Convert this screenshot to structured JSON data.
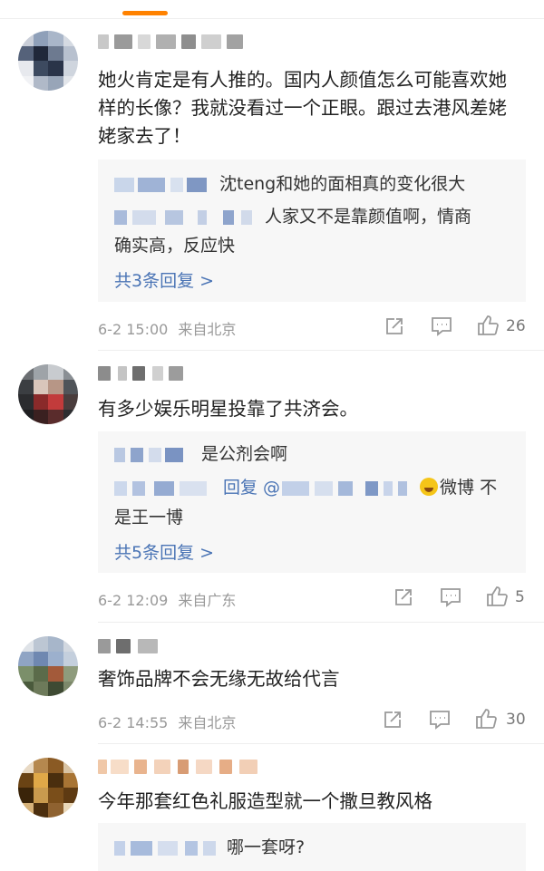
{
  "comments": [
    {
      "text": "她火肯定是有人推的。国内人颜值怎么可能喜欢她样的长像？我就没看过一个正眼。跟过去港风差姥姥家去了！",
      "replies": [
        "沈teng和她的面相真的变化很大",
        "人家又不是靠颜值啊，情商",
        "确实高，反应快"
      ],
      "more": "共3条回复 >",
      "time": "6-2 15:00",
      "source": "来自北京",
      "likes": "26"
    },
    {
      "text": "有多少娱乐明星投靠了共济会。",
      "replies": [
        "是公剂会啊",
        "回复 @",
        "微博 不",
        "是王一博"
      ],
      "more": "共5条回复 >",
      "time": "6-2 12:09",
      "source": "来自广东",
      "likes": "5"
    },
    {
      "text": "奢饰品牌不会无缘无故给代言",
      "time": "6-2 14:55",
      "source": "来自北京",
      "likes": "30"
    },
    {
      "text": "今年那套红色礼服造型就一个撒旦教风格",
      "replies": [
        "哪一套呀?"
      ]
    }
  ],
  "colors": {
    "accent": "#ff8200",
    "link": "#4a74b5"
  }
}
